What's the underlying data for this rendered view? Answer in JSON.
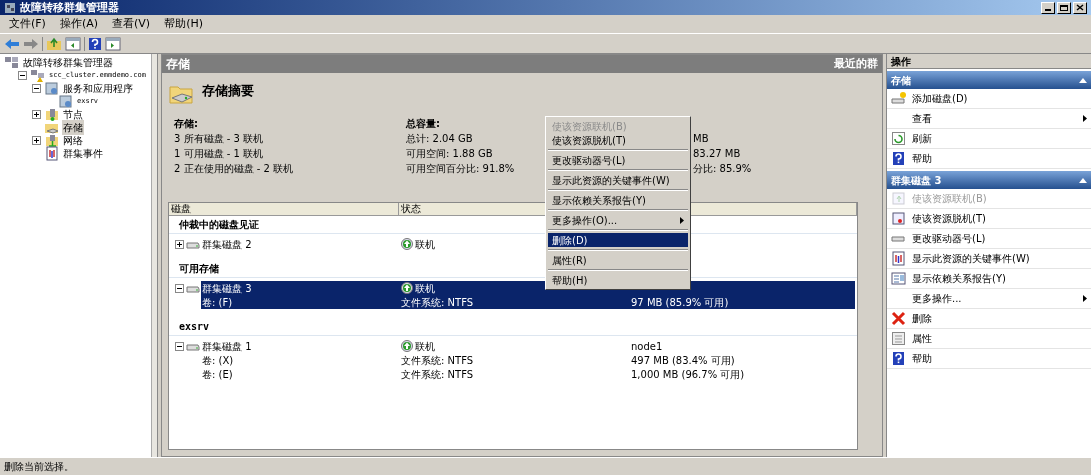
{
  "window": {
    "title": "故障转移群集管理器"
  },
  "menu_bar": [
    "文件(F)",
    "操作(A)",
    "查看(V)",
    "帮助(H)"
  ],
  "tree": [
    {
      "label": "故障转移群集管理器",
      "kind": "root",
      "selected": false,
      "children": [
        {
          "label": "scc_cluster.emmdemo.com",
          "kind": "cluster",
          "selected": false,
          "expanded": true,
          "children": [
            {
              "label": "服务和应用程序",
              "kind": "services",
              "selected": false,
              "expanded": true,
              "children": [
                {
                  "label": "exsrv",
                  "kind": "app",
                  "selected": false
                }
              ]
            },
            {
              "label": "节点",
              "kind": "nodes",
              "selected": false,
              "expanded": false
            },
            {
              "label": "存储",
              "kind": "storage",
              "selected": true
            },
            {
              "label": "网络",
              "kind": "network",
              "selected": false,
              "expanded": false
            },
            {
              "label": "群集事件",
              "kind": "events",
              "selected": false
            }
          ]
        }
      ]
    }
  ],
  "center": {
    "title": "存储",
    "recent": "最近的群",
    "summary_title": "存储摘要",
    "summary": [
      {
        "heading": "存储:",
        "lines": [
          "3 所有磁盘 - 3 联机",
          "1 可用磁盘 - 1 联机",
          "2 正在使用的磁盘 - 2 联机"
        ]
      },
      {
        "heading": "总容量:",
        "lines": [
          "总计: 2.04 GB",
          "可用空间: 1.88 GB",
          "可用空间百分比: 91.8%"
        ]
      },
      {
        "lines": [
          "MB",
          "83.27 MB",
          "分比: 85.9%"
        ]
      }
    ],
    "table": {
      "columns": [
        "磁盘",
        "状态"
      ],
      "rows": [
        {
          "kind": "group",
          "name": "仲裁中的磁盘见证"
        },
        {
          "kind": "disk",
          "name": "群集磁盘 2",
          "status": "联机",
          "expanded": false,
          "selected": false
        },
        {
          "kind": "group",
          "name": "可用存储"
        },
        {
          "kind": "disk",
          "name": "群集磁盘 3",
          "status": "联机",
          "expanded": true,
          "selected": true
        },
        {
          "kind": "volume",
          "name": "卷: (F)",
          "status": "文件系统: NTFS",
          "column_3": "97 MB (85.9% 可用)",
          "selected": true
        },
        {
          "kind": "group",
          "name": "exsrv"
        },
        {
          "kind": "disk",
          "name": "群集磁盘 1",
          "status": "联机",
          "column_3": "node1",
          "expanded": true,
          "selected": false
        },
        {
          "kind": "volume",
          "name": "卷: (X)",
          "status": "文件系统: NTFS",
          "column_3": "497 MB (83.4% 可用)",
          "selected": false
        },
        {
          "kind": "volume",
          "name": "卷: (E)",
          "status": "文件系统: NTFS",
          "column_3": "1,000 MB (96.7% 可用)",
          "selected": false
        }
      ]
    }
  },
  "context_menu": [
    {
      "label": "使该资源联机(B)",
      "disabled": true,
      "selected": false,
      "submenu": false
    },
    {
      "label": "使该资源脱机(T)",
      "disabled": false,
      "selected": false,
      "submenu": false
    },
    {
      "label": "更改驱动器号(L)",
      "disabled": false,
      "selected": false,
      "submenu": false
    },
    {
      "label": "显示此资源的关键事件(W)",
      "disabled": false,
      "selected": false,
      "submenu": false
    },
    {
      "label": "显示依赖关系报告(Y)",
      "disabled": false,
      "selected": false,
      "submenu": false
    },
    {
      "label": "更多操作(O)...",
      "disabled": false,
      "selected": false,
      "submenu": true
    },
    {
      "label": "删除(D)",
      "disabled": false,
      "selected": true,
      "submenu": false
    },
    {
      "label": "属性(R)",
      "disabled": false,
      "selected": false,
      "submenu": false
    },
    {
      "label": "帮助(H)",
      "disabled": false,
      "selected": false,
      "submenu": false
    }
  ],
  "actions": {
    "title": "操作",
    "sections": [
      {
        "title": "存储",
        "items": [
          {
            "label": "添加磁盘(D)",
            "kind": "add",
            "disabled": false,
            "submenu": false
          },
          {
            "label": "查看",
            "kind": "none",
            "disabled": false,
            "submenu": true
          },
          {
            "label": "刷新",
            "kind": "refresh",
            "disabled": false,
            "submenu": false
          },
          {
            "label": "帮助",
            "kind": "help",
            "disabled": false,
            "submenu": false
          }
        ]
      },
      {
        "title": "群集磁盘 3",
        "items": [
          {
            "label": "使该资源联机(B)",
            "kind": "online",
            "disabled": true,
            "submenu": false
          },
          {
            "label": "使该资源脱机(T)",
            "kind": "offline",
            "disabled": false,
            "submenu": false
          },
          {
            "label": "更改驱动器号(L)",
            "kind": "drive",
            "disabled": false,
            "submenu": false
          },
          {
            "label": "显示此资源的关键事件(W)",
            "kind": "events",
            "disabled": false,
            "submenu": false
          },
          {
            "label": "显示依赖关系报告(Y)",
            "kind": "report",
            "disabled": false,
            "submenu": false
          },
          {
            "label": "更多操作...",
            "kind": "none",
            "disabled": false,
            "submenu": true
          },
          {
            "label": "删除",
            "kind": "delete",
            "disabled": false,
            "submenu": false
          },
          {
            "label": "属性",
            "kind": "properties",
            "disabled": false,
            "submenu": false
          },
          {
            "label": "帮助",
            "kind": "help",
            "disabled": false,
            "submenu": false
          }
        ]
      }
    ]
  },
  "status_bar": "删除当前选择。"
}
